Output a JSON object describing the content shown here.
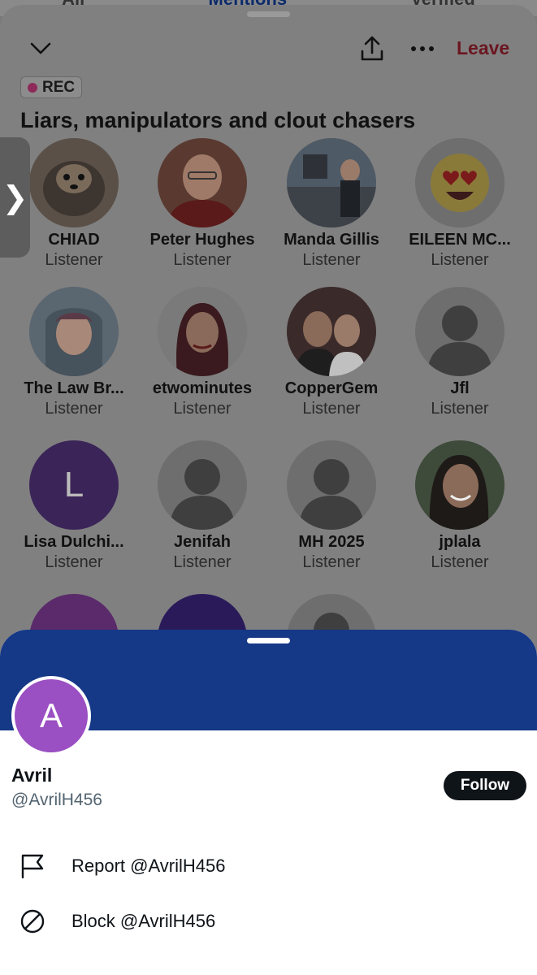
{
  "background_tabs": [
    "All",
    "Mentions",
    "Verified"
  ],
  "space": {
    "leave_label": "Leave",
    "rec_label": "REC",
    "title": "Liars, manipulators and clout chasers"
  },
  "participants": [
    {
      "name": "CHIAD",
      "role": "Listener",
      "avatar": "photo-dog"
    },
    {
      "name": "Peter Hughes",
      "role": "Listener",
      "avatar": "photo-man"
    },
    {
      "name": "Manda Gillis",
      "role": "Listener",
      "avatar": "photo-shop"
    },
    {
      "name": "EILEEN MC...",
      "role": "Listener",
      "avatar": "heart-eyes-emoji"
    },
    {
      "name": "The Law Br...",
      "role": "Listener",
      "avatar": "photo-woman-hood"
    },
    {
      "name": "etwominutes",
      "role": "Listener",
      "avatar": "cartoon-woman"
    },
    {
      "name": "CopperGem",
      "role": "Listener",
      "avatar": "photo-couple"
    },
    {
      "name": "Jfl",
      "role": "Listener",
      "avatar": "default-person"
    },
    {
      "name": "Lisa Dulchi...",
      "role": "Listener",
      "avatar": "letter",
      "letter": "L"
    },
    {
      "name": "Jenifah",
      "role": "Listener",
      "avatar": "default-person"
    },
    {
      "name": "MH 2025",
      "role": "Listener",
      "avatar": "default-person"
    },
    {
      "name": "jplala",
      "role": "Listener",
      "avatar": "photo-woman-smile"
    }
  ],
  "profile": {
    "name": "Avril",
    "handle": "@AvrilH456",
    "avatar_letter": "A",
    "follow_label": "Follow",
    "actions": [
      {
        "label": "Report @AvrilH456",
        "icon": "flag-icon"
      },
      {
        "label": "Block @AvrilH456",
        "icon": "block-icon"
      }
    ]
  },
  "colors": {
    "banner": "#153887",
    "avatar": "#9a4fc2",
    "leave": "#6b1620"
  }
}
